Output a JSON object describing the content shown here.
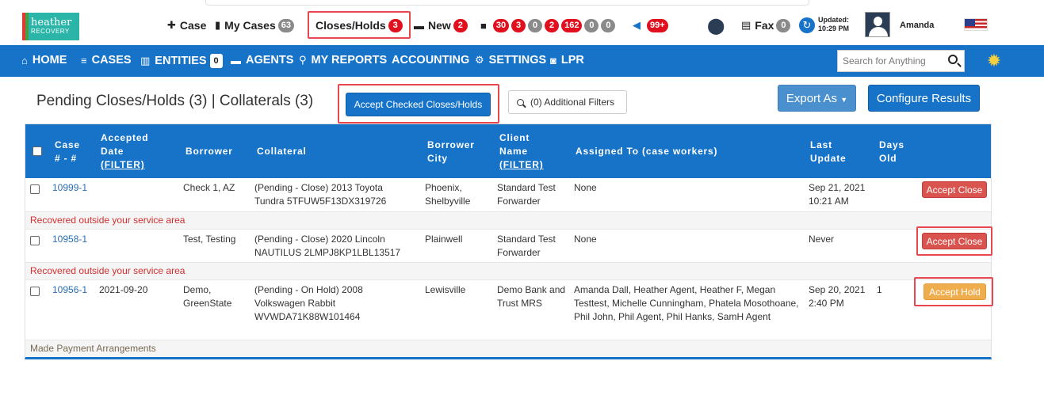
{
  "logo": {
    "line1": "heather",
    "line2": "RECOVERY"
  },
  "topnav": {
    "case_label": "Case",
    "mycases_label": "My Cases",
    "mycases_count": "63",
    "closes_label": "Closes/Holds",
    "closes_count": "3",
    "new_label": "New",
    "new_count": "2",
    "truck_counts": [
      "30",
      "3",
      "0",
      "2",
      "162",
      "0",
      "0"
    ],
    "announce_count": "99+",
    "fax_label": "Fax",
    "fax_count": "0",
    "updated_label": "Updated:",
    "updated_time": "10:29 PM",
    "user_name": "Amanda"
  },
  "mainnav": {
    "home": "HOME",
    "cases": "CASES",
    "entities": "ENTITIES",
    "entities_count": "0",
    "agents": "AGENTS",
    "reports": "MY REPORTS",
    "accounting": "ACCOUNTING",
    "settings": "SETTINGS",
    "lpr": "LPR",
    "search_placeholder": "Search for Anything"
  },
  "page": {
    "title": "Pending Closes/Holds (3) | Collaterals (3)",
    "accept_button": "Accept Checked Closes/Holds",
    "filters_button": "(0) Additional Filters",
    "export_button": "Export As",
    "config_button": "Configure Results"
  },
  "table": {
    "headers": {
      "case": "Case",
      "case2": "# - #",
      "accepted": "Accepted",
      "accepted2": "Date",
      "filter": "(FILTER)",
      "borrower": "Borrower",
      "collateral": "Collateral",
      "borrower_city": "Borrower",
      "borrower_city2": "City",
      "client": "Client",
      "client2": "Name",
      "assigned": "Assigned To (case workers)",
      "last_update": "Last",
      "last_update2": "Update",
      "days_old": "Days",
      "days_old2": "Old"
    },
    "rows": [
      {
        "case": "10999-1",
        "accepted": "",
        "borrower": "Check 1, AZ",
        "collateral": "(Pending - Close) 2013 Toyota Tundra 5TFUW5F13DX319726",
        "city": "Phoenix, Shelbyville",
        "client": "Standard Test Forwarder",
        "assigned": "None",
        "last_update": "Sep 21, 2021 10:21 AM",
        "days": "",
        "action": "Accept Close",
        "note": "Recovered outside your service area"
      },
      {
        "case": "10958-1",
        "accepted": "",
        "borrower": "Test, Testing",
        "collateral": "(Pending - Close) 2020 Lincoln NAUTILUS 2LMPJ8KP1LBL13517",
        "city": "Plainwell",
        "client": "Standard Test Forwarder",
        "assigned": "None",
        "last_update": "Never",
        "days": "",
        "action": "Accept Close",
        "note": "Recovered outside your service area"
      },
      {
        "case": "10956-1",
        "accepted": "2021-09-20",
        "borrower": "Demo, GreenState",
        "collateral": "(Pending - On Hold) 2008 Volkswagen Rabbit WVWDA71K88W101464",
        "city": "Lewisville",
        "client": "Demo Bank and Trust MRS",
        "assigned": "Amanda Dall, Heather Agent, Heather F, Megan Testtest, Michelle Cunningham, Phatela Mosothoane, Phil John, Phil Agent, Phil Hanks, SamH Agent",
        "last_update": "Sep 20, 2021 2:40 PM",
        "days": "1",
        "action": "Accept Hold",
        "note": "Made Payment Arrangements"
      }
    ]
  },
  "colors": {
    "primary": "#1673c8",
    "danger": "#d9534f",
    "warning": "#f0ad4e",
    "badge_red": "#e0101e",
    "highlight": "#e8474f"
  }
}
